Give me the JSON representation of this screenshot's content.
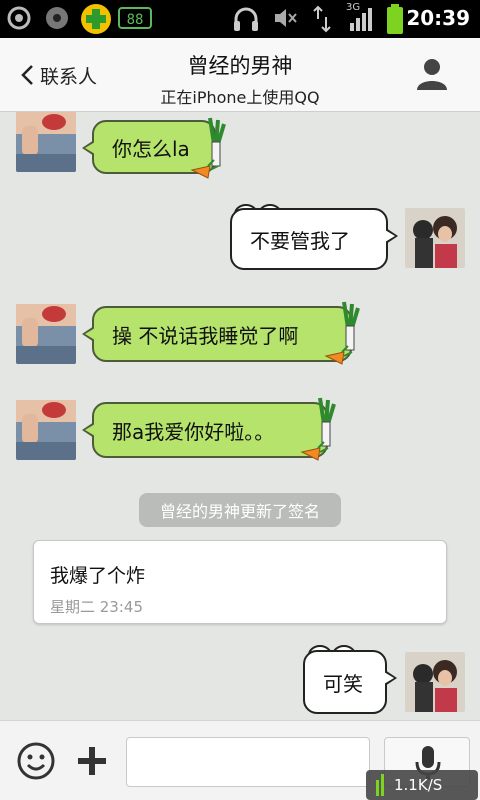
{
  "status_bar": {
    "time": "20:39",
    "network_type": "3G",
    "icons": [
      "settings-icon",
      "media-icon",
      "360-security-icon",
      "battery-widget-icon",
      "headset-icon",
      "mute-icon",
      "data-transfer-icon",
      "signal-icon",
      "battery-icon"
    ]
  },
  "header": {
    "back_label": "联系人",
    "title": "曾经的男神",
    "subtitle": "正在iPhone上使用QQ",
    "profile_icon": "person-icon"
  },
  "messages": [
    {
      "side": "left",
      "text": "你怎么la"
    },
    {
      "side": "right",
      "text": "不要管我了"
    },
    {
      "side": "left",
      "text": "操  不说话我睡觉了啊"
    },
    {
      "side": "left",
      "text": "那a我爱你好啦。。"
    },
    {
      "side": "right",
      "text": "可笑"
    }
  ],
  "system_notice": "曾经的男神更新了签名",
  "signature_card": {
    "text": "我爆了个炸",
    "time": "星期二 23:45"
  },
  "input_bar": {
    "emoji_icon": "smiley-icon",
    "plus_icon": "plus-icon",
    "mic_icon": "microphone-icon",
    "input_value": ""
  },
  "network_speed": "1.1K/S",
  "colors": {
    "left_bubble": "#b5e36c",
    "right_bubble": "#ffffff",
    "chat_bg": "#e4e6e3"
  }
}
